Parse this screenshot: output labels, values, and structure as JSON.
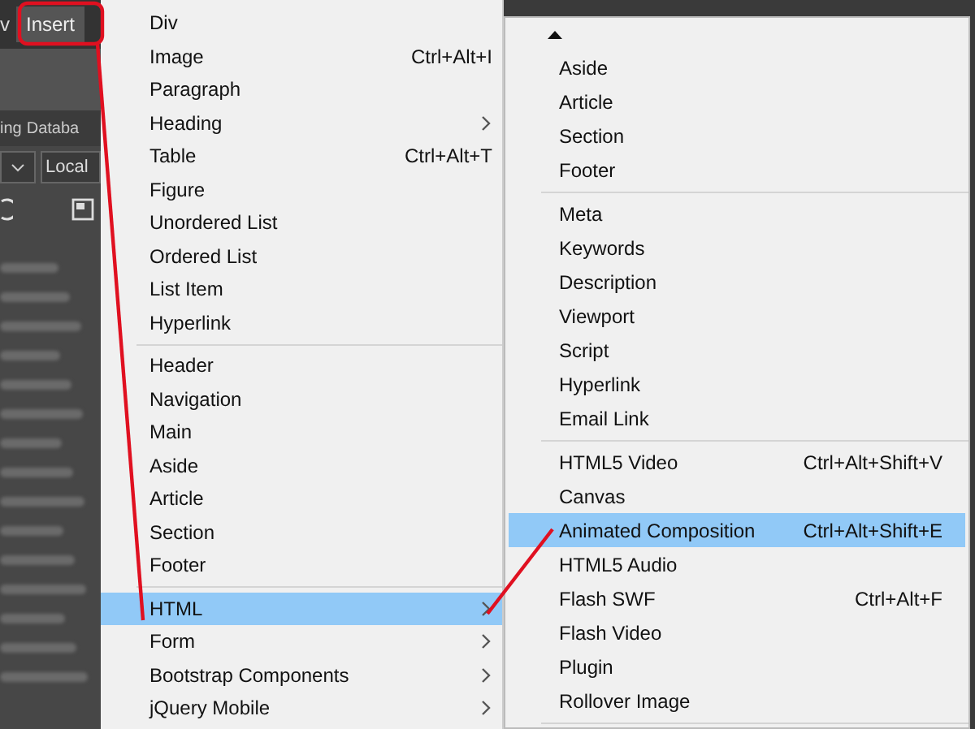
{
  "menubar": {
    "cut_item": "v",
    "insert_button": {
      "label": "Insert",
      "selected": true
    }
  },
  "panel": {
    "tabs": [
      "ing",
      "Databa"
    ],
    "dropdown_value": "Local"
  },
  "menu": {
    "items": [
      {
        "kind": "item",
        "label": "Div",
        "submenu": false,
        "selected": false
      },
      {
        "kind": "item",
        "label": "Image",
        "shortcut": "Ctrl+Alt+I",
        "submenu": false,
        "selected": false
      },
      {
        "kind": "item",
        "label": "Paragraph",
        "submenu": false,
        "selected": false
      },
      {
        "kind": "item",
        "label": "Heading",
        "submenu": true,
        "selected": false
      },
      {
        "kind": "item",
        "label": "Table",
        "shortcut": "Ctrl+Alt+T",
        "submenu": false,
        "selected": false
      },
      {
        "kind": "item",
        "label": "Figure",
        "submenu": false,
        "selected": false
      },
      {
        "kind": "item",
        "label": "Unordered List",
        "submenu": false,
        "selected": false
      },
      {
        "kind": "item",
        "label": "Ordered List",
        "submenu": false,
        "selected": false
      },
      {
        "kind": "item",
        "label": "List Item",
        "submenu": false,
        "selected": false
      },
      {
        "kind": "item",
        "label": "Hyperlink",
        "submenu": false,
        "selected": false
      },
      {
        "kind": "separator"
      },
      {
        "kind": "item",
        "label": "Header",
        "submenu": false,
        "selected": false
      },
      {
        "kind": "item",
        "label": "Navigation",
        "submenu": false,
        "selected": false
      },
      {
        "kind": "item",
        "label": "Main",
        "submenu": false,
        "selected": false
      },
      {
        "kind": "item",
        "label": "Aside",
        "submenu": false,
        "selected": false
      },
      {
        "kind": "item",
        "label": "Article",
        "submenu": false,
        "selected": false
      },
      {
        "kind": "item",
        "label": "Section",
        "submenu": false,
        "selected": false
      },
      {
        "kind": "item",
        "label": "Footer",
        "submenu": false,
        "selected": false
      },
      {
        "kind": "separator"
      },
      {
        "kind": "item",
        "label": "HTML",
        "submenu": true,
        "selected": true
      },
      {
        "kind": "item",
        "label": "Form",
        "submenu": true,
        "selected": false
      },
      {
        "kind": "item",
        "label": "Bootstrap Components",
        "submenu": true,
        "selected": false
      },
      {
        "kind": "item",
        "label": "jQuery Mobile",
        "submenu": true,
        "selected": false
      }
    ]
  },
  "submenu": {
    "items": [
      {
        "kind": "item",
        "label": "Aside",
        "submenu": false,
        "selected": false
      },
      {
        "kind": "item",
        "label": "Article",
        "submenu": false,
        "selected": false
      },
      {
        "kind": "item",
        "label": "Section",
        "submenu": false,
        "selected": false
      },
      {
        "kind": "item",
        "label": "Footer",
        "submenu": false,
        "selected": false
      },
      {
        "kind": "separator"
      },
      {
        "kind": "item",
        "label": "Meta",
        "submenu": false,
        "selected": false
      },
      {
        "kind": "item",
        "label": "Keywords",
        "submenu": false,
        "selected": false
      },
      {
        "kind": "item",
        "label": "Description",
        "submenu": false,
        "selected": false
      },
      {
        "kind": "item",
        "label": "Viewport",
        "submenu": false,
        "selected": false
      },
      {
        "kind": "item",
        "label": "Script",
        "submenu": false,
        "selected": false
      },
      {
        "kind": "item",
        "label": "Hyperlink",
        "submenu": false,
        "selected": false
      },
      {
        "kind": "item",
        "label": "Email Link",
        "submenu": false,
        "selected": false
      },
      {
        "kind": "separator"
      },
      {
        "kind": "item",
        "label": "HTML5 Video",
        "shortcut": "Ctrl+Alt+Shift+V",
        "submenu": false,
        "selected": false
      },
      {
        "kind": "item",
        "label": "Canvas",
        "submenu": false,
        "selected": false
      },
      {
        "kind": "item",
        "label": "Animated Composition",
        "shortcut": "Ctrl+Alt+Shift+E",
        "submenu": false,
        "selected": true
      },
      {
        "kind": "item",
        "label": "HTML5 Audio",
        "submenu": false,
        "selected": false
      },
      {
        "kind": "item",
        "label": "Flash SWF",
        "shortcut": "Ctrl+Alt+F",
        "submenu": false,
        "selected": false
      },
      {
        "kind": "item",
        "label": "Flash Video",
        "submenu": false,
        "selected": false
      },
      {
        "kind": "item",
        "label": "Plugin",
        "submenu": false,
        "selected": false
      },
      {
        "kind": "item",
        "label": "Rollover Image",
        "submenu": false,
        "selected": false
      },
      {
        "kind": "separator"
      }
    ]
  }
}
